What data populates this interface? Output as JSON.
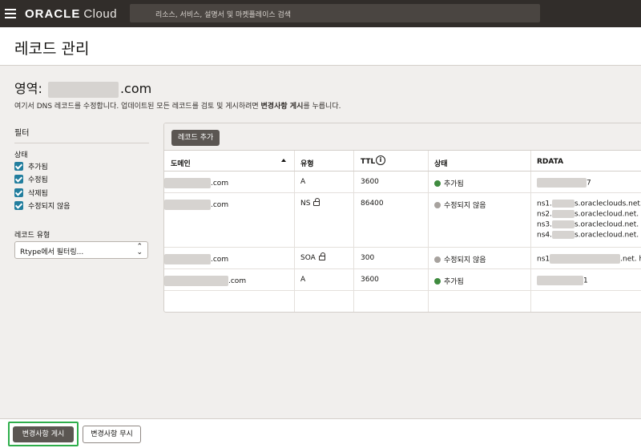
{
  "topbar": {
    "brand": "ORACLE",
    "product": "Cloud",
    "search_placeholder": "리소스, 서비스, 설명서 및 마켓플레이스 검색"
  },
  "page": {
    "title": "레코드 관리"
  },
  "zone": {
    "prefix": "영역:",
    "suffix": ".com",
    "desc_before": "여기서 DNS 레코드를 수정합니다. 업데이트된 모든 레코드를 검토 및 게시하려면 ",
    "desc_bold": "변경사항 게시",
    "desc_after": "를 누릅니다."
  },
  "filters": {
    "title": "필터",
    "status_label": "상태",
    "statuses": [
      "추가됨",
      "수정됨",
      "삭제됨",
      "수정되지 않음"
    ],
    "record_type_label": "레코드 유형",
    "record_type_placeholder": "Rtype에서 필터링..."
  },
  "table": {
    "add_button": "레코드 추가",
    "headers": {
      "domain": "도메인",
      "type": "유형",
      "ttl": "TTL",
      "status": "상태",
      "rdata": "RDATA"
    },
    "rows": [
      {
        "domain": ".com",
        "type": "A",
        "ttl": "3600",
        "status": "추가됨",
        "status_color": "#3f8b3f",
        "rdata": [
          "7"
        ]
      },
      {
        "domain": ".com",
        "type": "NS",
        "ttl": "86400",
        "status": "수정되지 않음",
        "status_color": "#a7a29e",
        "rdata": [
          "ns1.",
          "s.oracleclouds.net.",
          "ns2.",
          "s.oraclecloud.net.",
          "ns3.",
          "s.oraclecloud.net.",
          "ns4.",
          "s.oraclecloud.net."
        ]
      },
      {
        "domain": ".com",
        "type": "SOA",
        "ttl": "300",
        "status": "수정되지 않음",
        "status_color": "#a7a29e",
        "rdata": [
          "ns1",
          ".net. h"
        ]
      },
      {
        "domain": ".com",
        "type": "A",
        "ttl": "3600",
        "status": "추가됨",
        "status_color": "#3f8b3f",
        "rdata": [
          "1"
        ]
      }
    ]
  },
  "footer": {
    "publish": "변경사항 게시",
    "discard": "변경사항 무시"
  }
}
